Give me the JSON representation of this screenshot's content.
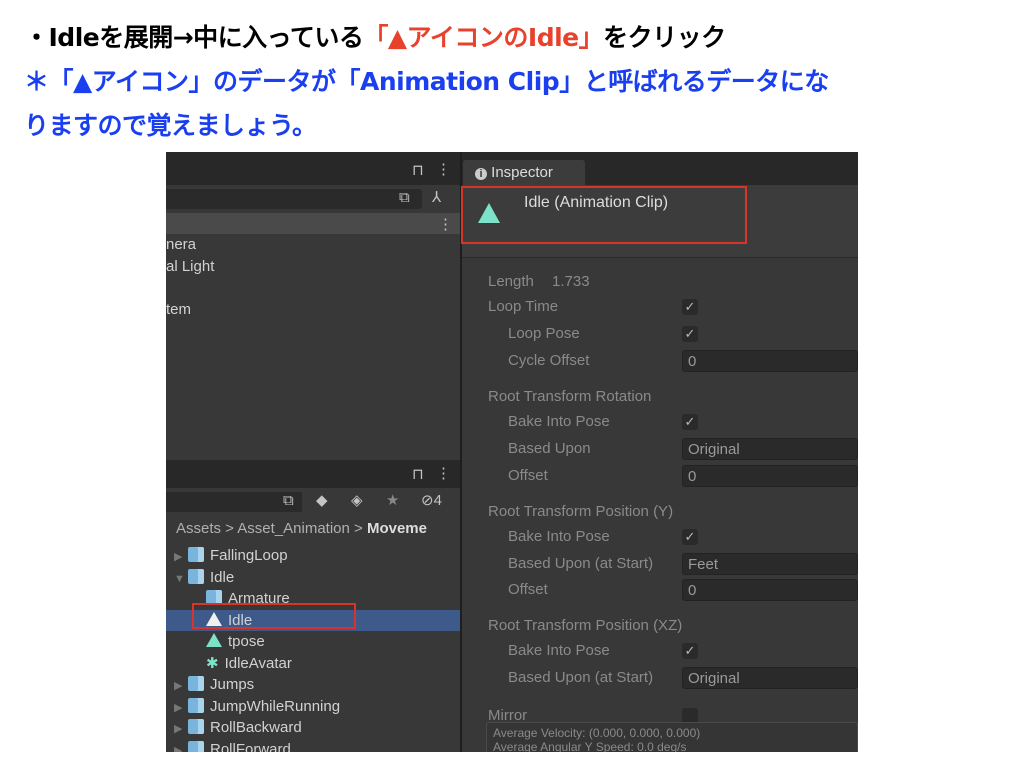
{
  "instructions": {
    "line1_prefix": "・Idleを展開→中に入っている",
    "line1_highlight": "「▲アイコンのIdle」",
    "line1_suffix": "をクリック",
    "line2": "＊「▲アイコン」のデータが「Animation Clip」と呼ばれるデータにな",
    "line3": "りますので覚えましょう。"
  },
  "colors": {
    "highlight": "#e8412c",
    "note": "#1a3ff0",
    "selection": "#3e5a8a"
  },
  "hierarchy": {
    "items": [
      "nera",
      "al Light",
      "tem"
    ]
  },
  "project": {
    "hidden_count": "4",
    "breadcrumb": [
      "Assets",
      "Asset_Animation",
      "Moveme"
    ],
    "items": [
      {
        "label": "FallingLoop",
        "icon": "model-icon",
        "depth": 0,
        "arrow": "▶"
      },
      {
        "label": "Idle",
        "icon": "model-icon",
        "depth": 0,
        "arrow": "▼"
      },
      {
        "label": "Armature",
        "icon": "model-icon",
        "depth": 1,
        "arrow": ""
      },
      {
        "label": "Idle",
        "icon": "animation-clip-icon",
        "depth": 1,
        "arrow": "",
        "selected": true
      },
      {
        "label": "tpose",
        "icon": "animation-clip-icon",
        "depth": 1,
        "arrow": ""
      },
      {
        "label": "IdleAvatar",
        "icon": "avatar-icon",
        "depth": 1,
        "arrow": ""
      },
      {
        "label": "Jumps",
        "icon": "model-icon",
        "depth": 0,
        "arrow": "▶"
      },
      {
        "label": "JumpWhileRunning",
        "icon": "model-icon",
        "depth": 0,
        "arrow": "▶"
      },
      {
        "label": "RollBackward",
        "icon": "model-icon",
        "depth": 0,
        "arrow": "▶"
      },
      {
        "label": "RollForward",
        "icon": "model-icon",
        "depth": 0,
        "arrow": "▶"
      }
    ]
  },
  "inspector": {
    "tab_label": "Inspector",
    "title": "Idle (Animation Clip)",
    "rows": [
      {
        "label": "Length",
        "value": "1.733",
        "kind": "text",
        "indent": false
      },
      {
        "label": "Loop Time",
        "kind": "check",
        "checked": true,
        "indent": false
      },
      {
        "label": "Loop Pose",
        "kind": "check",
        "checked": true,
        "indent": true
      },
      {
        "label": "Cycle Offset",
        "kind": "field",
        "value": "0",
        "indent": true
      },
      {
        "label": "Root Transform Rotation",
        "kind": "header",
        "indent": false
      },
      {
        "label": "Bake Into Pose",
        "kind": "check",
        "checked": true,
        "indent": true
      },
      {
        "label": "Based Upon",
        "kind": "field",
        "value": "Original",
        "indent": true
      },
      {
        "label": "Offset",
        "kind": "field",
        "value": "0",
        "indent": true
      },
      {
        "label": "Root Transform Position (Y)",
        "kind": "header",
        "indent": false
      },
      {
        "label": "Bake Into Pose",
        "kind": "check",
        "checked": true,
        "indent": true
      },
      {
        "label": "Based Upon (at Start)",
        "kind": "field",
        "value": "Feet",
        "indent": true
      },
      {
        "label": "Offset",
        "kind": "field",
        "value": "0",
        "indent": true
      },
      {
        "label": "Root Transform Position (XZ)",
        "kind": "header",
        "indent": false
      },
      {
        "label": "Bake Into Pose",
        "kind": "check",
        "checked": true,
        "indent": true
      },
      {
        "label": "Based Upon (at Start)",
        "kind": "field",
        "value": "Original",
        "indent": true
      },
      {
        "label": "Mirror",
        "kind": "check",
        "checked": false,
        "indent": false
      }
    ],
    "summary": [
      "Average Velocity: (0.000, 0.000, 0.000)",
      "Average Angular Y Speed: 0.0 deg/s"
    ]
  }
}
